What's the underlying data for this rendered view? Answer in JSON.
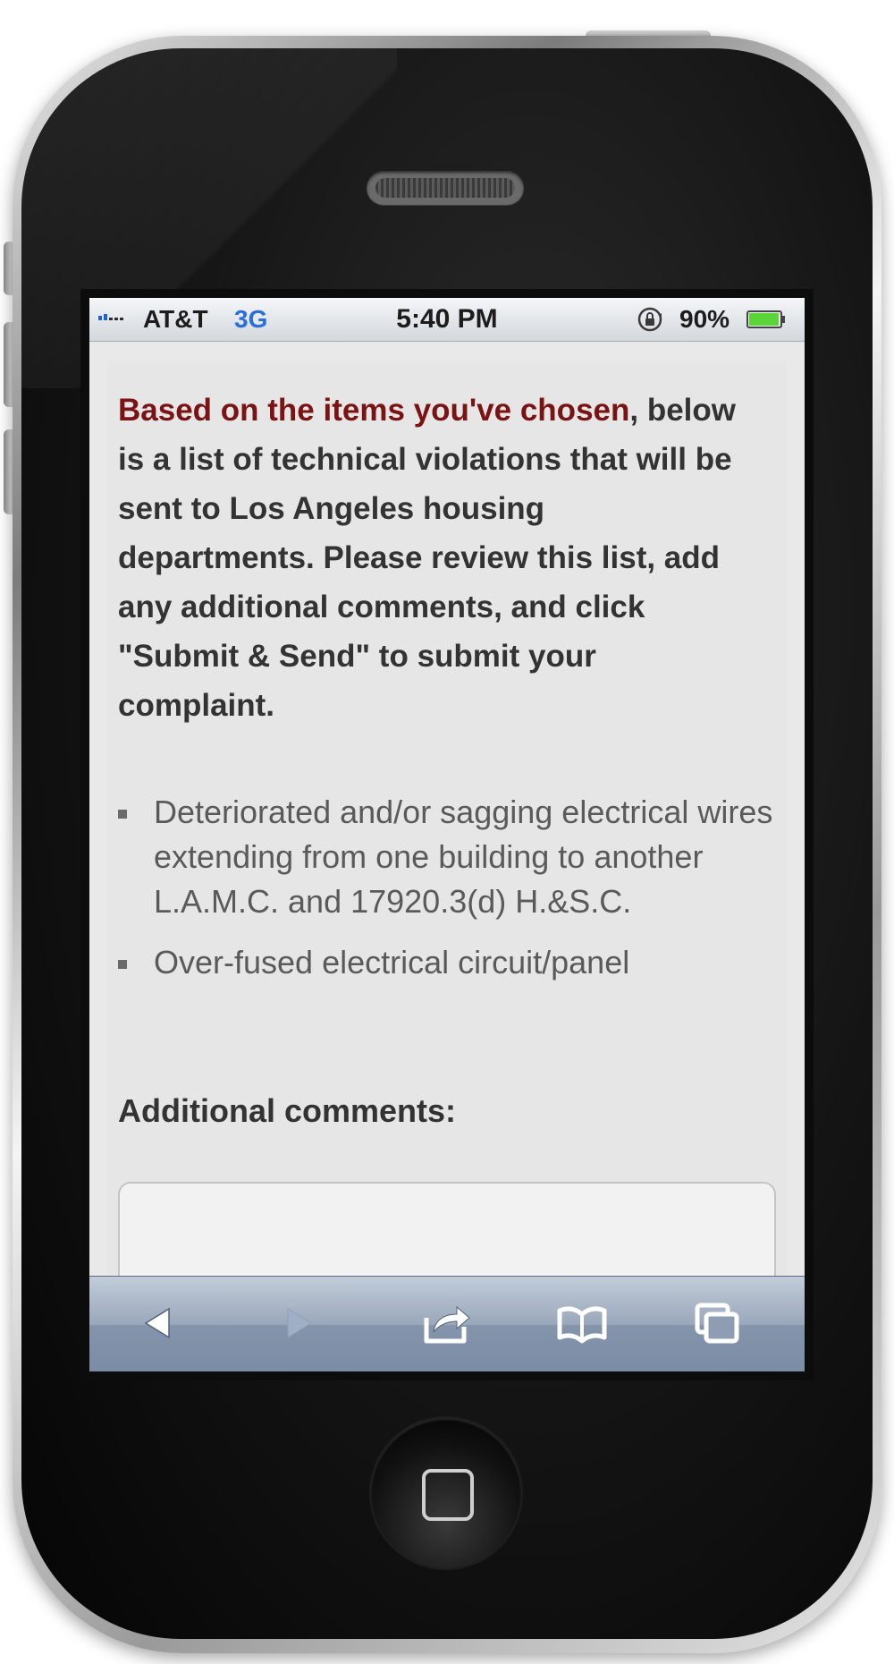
{
  "status_bar": {
    "carrier": "AT&T",
    "network": "3G",
    "time": "5:40 PM",
    "battery_percent": "90%",
    "icons": [
      "signal-icon",
      "rotation-lock-icon",
      "battery-icon"
    ]
  },
  "intro": {
    "highlight": "Based on the items you've chosen",
    "rest": ", below is a list of technical violations that will be sent to Los Angeles housing departments. Please review this list, add any additional comments, and click \"Submit & Send\" to submit your complaint."
  },
  "violations": [
    "Deteriorated and/or sagging electrical wires extending from one building to another L.A.M.C. and 17920.3(d) H.&S.C.",
    "Over-fused electrical circuit/panel"
  ],
  "comments": {
    "label": "Additional comments:",
    "value": ""
  },
  "toolbar": {
    "buttons": [
      "back-icon",
      "forward-icon",
      "share-icon",
      "bookmarks-icon",
      "tabs-icon"
    ]
  },
  "colors": {
    "highlight": "#7a1414",
    "network": "#2a6fd8",
    "battery_fill": "#5bd43a"
  }
}
